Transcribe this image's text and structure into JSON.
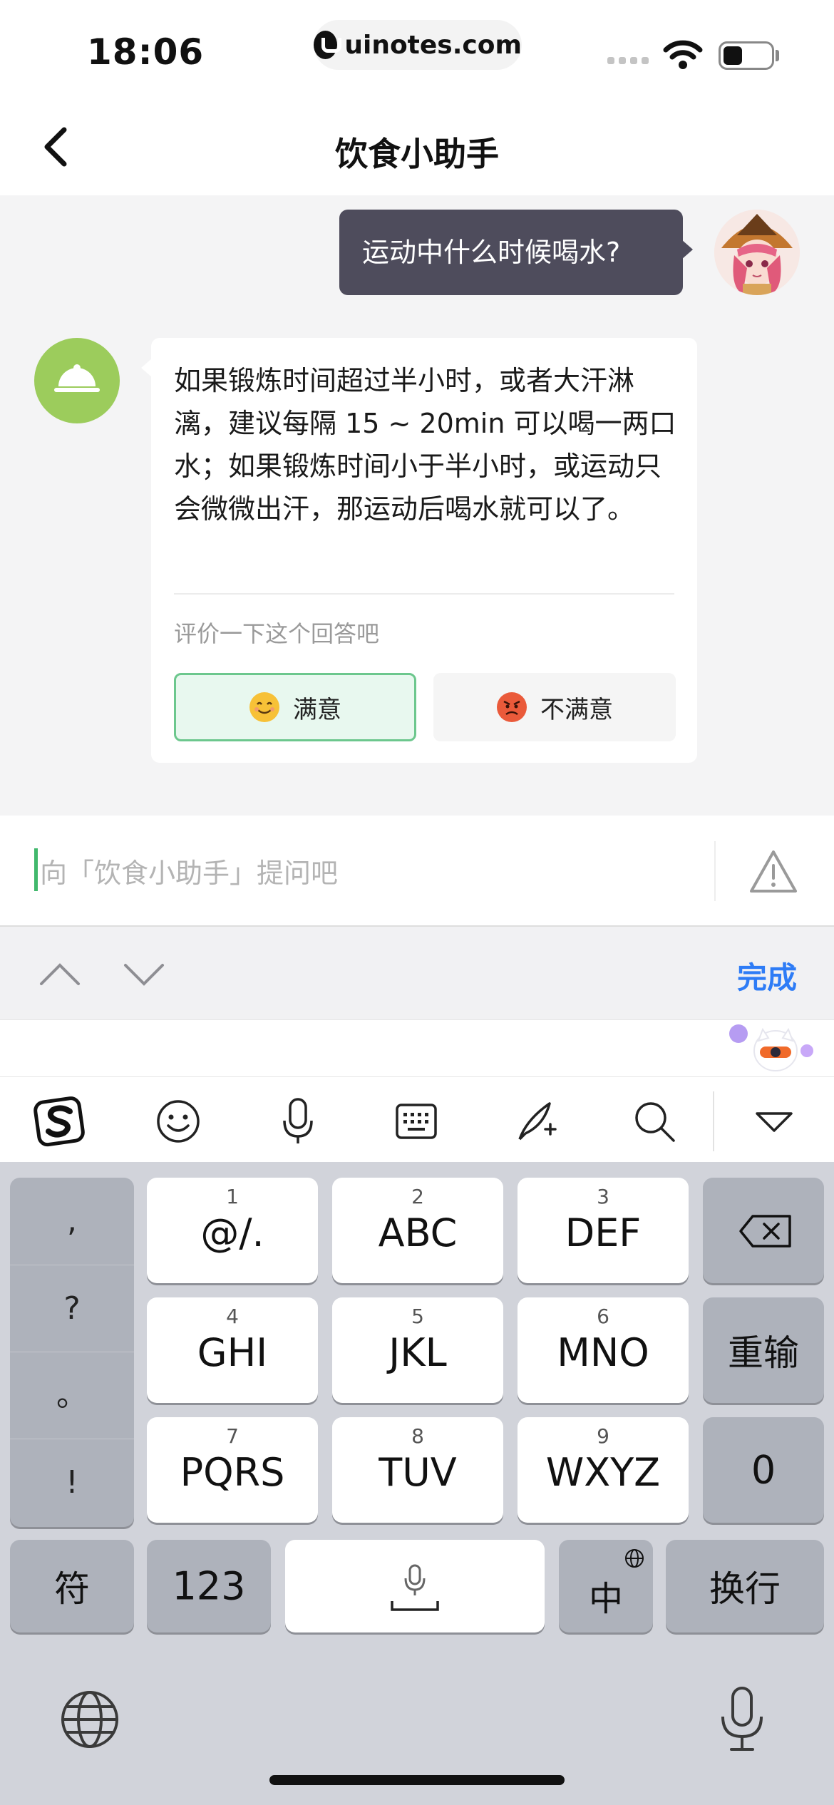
{
  "status_bar": {
    "time": "18:06",
    "url": "uinotes.com",
    "battery_level": 0.4
  },
  "nav": {
    "title": "饮食小助手"
  },
  "chat": {
    "user_message": "运动中什么时候喝水?",
    "bot_answer": "如果锻炼时间超过半小时，或者大汗淋漓，建议每隔 15 ~ 20min 可以喝一两口水；如果锻炼时间小于半小时，或运动只会微微出汗，那运动后喝水就可以了。",
    "rate_prompt": "评价一下这个回答吧",
    "rate_good": "满意",
    "rate_bad": "不满意"
  },
  "input": {
    "placeholder": "向「饮食小助手」提问吧"
  },
  "keyboard_toolbar": {
    "done": "完成"
  },
  "keyboard": {
    "punct": [
      ",",
      "?",
      "。",
      "!"
    ],
    "keys": [
      {
        "num": "1",
        "label": "@/."
      },
      {
        "num": "2",
        "label": "ABC"
      },
      {
        "num": "3",
        "label": "DEF"
      },
      {
        "num": "4",
        "label": "GHI"
      },
      {
        "num": "5",
        "label": "JKL"
      },
      {
        "num": "6",
        "label": "MNO"
      },
      {
        "num": "7",
        "label": "PQRS"
      },
      {
        "num": "8",
        "label": "TUV"
      },
      {
        "num": "9",
        "label": "WXYZ"
      }
    ],
    "reenter": "重输",
    "zero": "0",
    "symbols": "符",
    "numbers": "123",
    "lang": "中",
    "enter": "换行"
  },
  "colors": {
    "accent_green": "#6cc78d",
    "user_bubble": "#4e4c5c",
    "done_blue": "#2e7cf6",
    "bot_avatar": "#9ccc5c"
  }
}
